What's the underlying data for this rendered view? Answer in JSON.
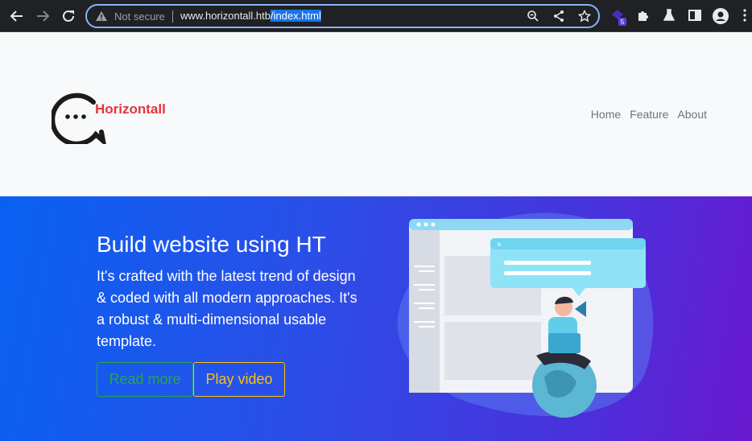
{
  "browser": {
    "security_label": "Not secure",
    "url_domain": "www.horizontall.htb",
    "url_path": "/index.html",
    "extension_badge": "5",
    "icons": [
      "back-arrow-icon",
      "forward-arrow-icon",
      "reload-icon",
      "warning-icon",
      "zoom-icon",
      "share-icon",
      "star-icon",
      "extension-icon",
      "puzzle-icon",
      "flask-icon",
      "sidebar-icon",
      "profile-icon",
      "kebab-menu-icon"
    ],
    "accent": "#8ab4f8"
  },
  "site": {
    "brand": "Horizontall",
    "brand_color": "#e5343d",
    "nav": [
      "Home",
      "Feature",
      "About"
    ]
  },
  "hero": {
    "title": "Build website using HT",
    "text": "It's crafted with the latest trend of design & coded with all modern approaches. It's a robust & multi-dimensional usable template.",
    "read_more": "Read more",
    "play_video": "Play video",
    "read_color": "#28a745",
    "play_color": "#ffc107"
  }
}
